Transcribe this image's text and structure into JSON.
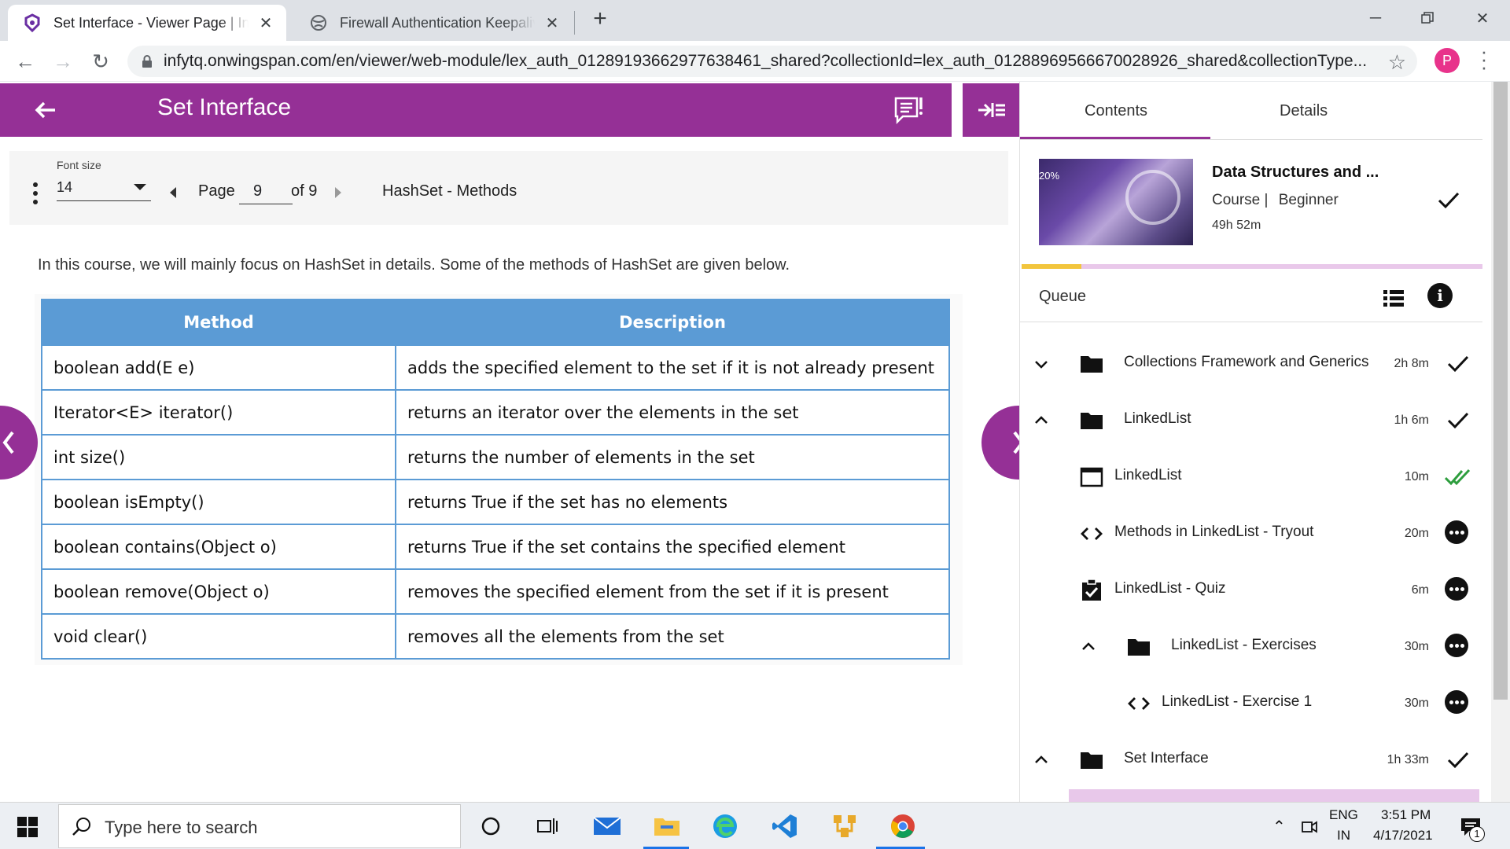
{
  "browser": {
    "tabs": [
      {
        "title": "Set Interface - Viewer Page | Infy",
        "active": true
      },
      {
        "title": "Firewall Authentication Keepalive",
        "active": false
      }
    ],
    "url": "infytq.onwingspan.com/en/viewer/web-module/lex_auth_01289193662977638461_shared?collectionId=lex_auth_01288969566670028926_shared&collectionType...",
    "profile_initial": "P"
  },
  "header": {
    "title": "Set Interface"
  },
  "controls": {
    "font_size_label": "Font size",
    "font_size_value": "14",
    "page_label": "Page",
    "page_current": "9",
    "page_total": "of 9",
    "topic": "HashSet - Methods"
  },
  "content": {
    "intro": "In this course, we will mainly focus on HashSet in details. Some of the methods of HashSet are given below.",
    "table": {
      "headers": [
        "Method",
        "Description"
      ],
      "rows": [
        [
          "boolean add(E e)",
          "adds the specified element to the set if it is not already present"
        ],
        [
          "Iterator<E> iterator()",
          "returns an iterator over the elements in the set"
        ],
        [
          "int size()",
          "returns the number of elements in the set"
        ],
        [
          "boolean isEmpty()",
          "returns True if the set has no elements"
        ],
        [
          "boolean contains(Object o)",
          "returns True if the set contains the specified element"
        ],
        [
          "boolean remove(Object o)",
          "removes the specified element from the set if it is present"
        ],
        [
          "void clear()",
          "removes all the elements from the set"
        ]
      ]
    }
  },
  "sidebar": {
    "tabs": [
      "Contents",
      "Details"
    ],
    "course": {
      "title": "Data Structures and ...",
      "type": "Course |",
      "level": "Beginner",
      "duration": "49h 52m",
      "progress_fraction": 0.13
    },
    "queue_label": "Queue",
    "items": [
      {
        "name": "Collections Framework and Generics",
        "duration": "2h 8m",
        "icon": "folder-icon",
        "chevron": "down",
        "status": "done"
      },
      {
        "name": "LinkedList",
        "duration": "1h 6m",
        "icon": "folder-icon",
        "chevron": "up",
        "status": "done"
      },
      {
        "name": "LinkedList",
        "duration": "10m",
        "icon": "web-module-icon",
        "chevron": "",
        "status": "double-done"
      },
      {
        "name": "Methods in LinkedList - Tryout",
        "duration": "20m",
        "icon": "code-icon",
        "chevron": "",
        "status": "more"
      },
      {
        "name": "LinkedList - Quiz",
        "duration": "6m",
        "icon": "quiz-icon",
        "chevron": "",
        "status": "more"
      },
      {
        "name": "LinkedList - Exercises",
        "duration": "30m",
        "icon": "folder-icon",
        "chevron": "up",
        "status": "more"
      },
      {
        "name": "LinkedList - Exercise 1",
        "duration": "30m",
        "icon": "code-icon",
        "chevron": "",
        "status": "more"
      },
      {
        "name": "Set Interface",
        "duration": "1h 33m",
        "icon": "folder-icon",
        "chevron": "up",
        "status": "done"
      }
    ]
  },
  "taskbar": {
    "search_placeholder": "Type here to search",
    "lang_top": "ENG",
    "lang_bottom": "IN",
    "time": "3:51 PM",
    "date": "4/17/2021",
    "notification_count": "1"
  },
  "colors": {
    "brand_purple": "#953096",
    "table_blue": "#5b9bd5",
    "progress_yellow": "#f2c53d",
    "check_green": "#2e9e3e"
  }
}
